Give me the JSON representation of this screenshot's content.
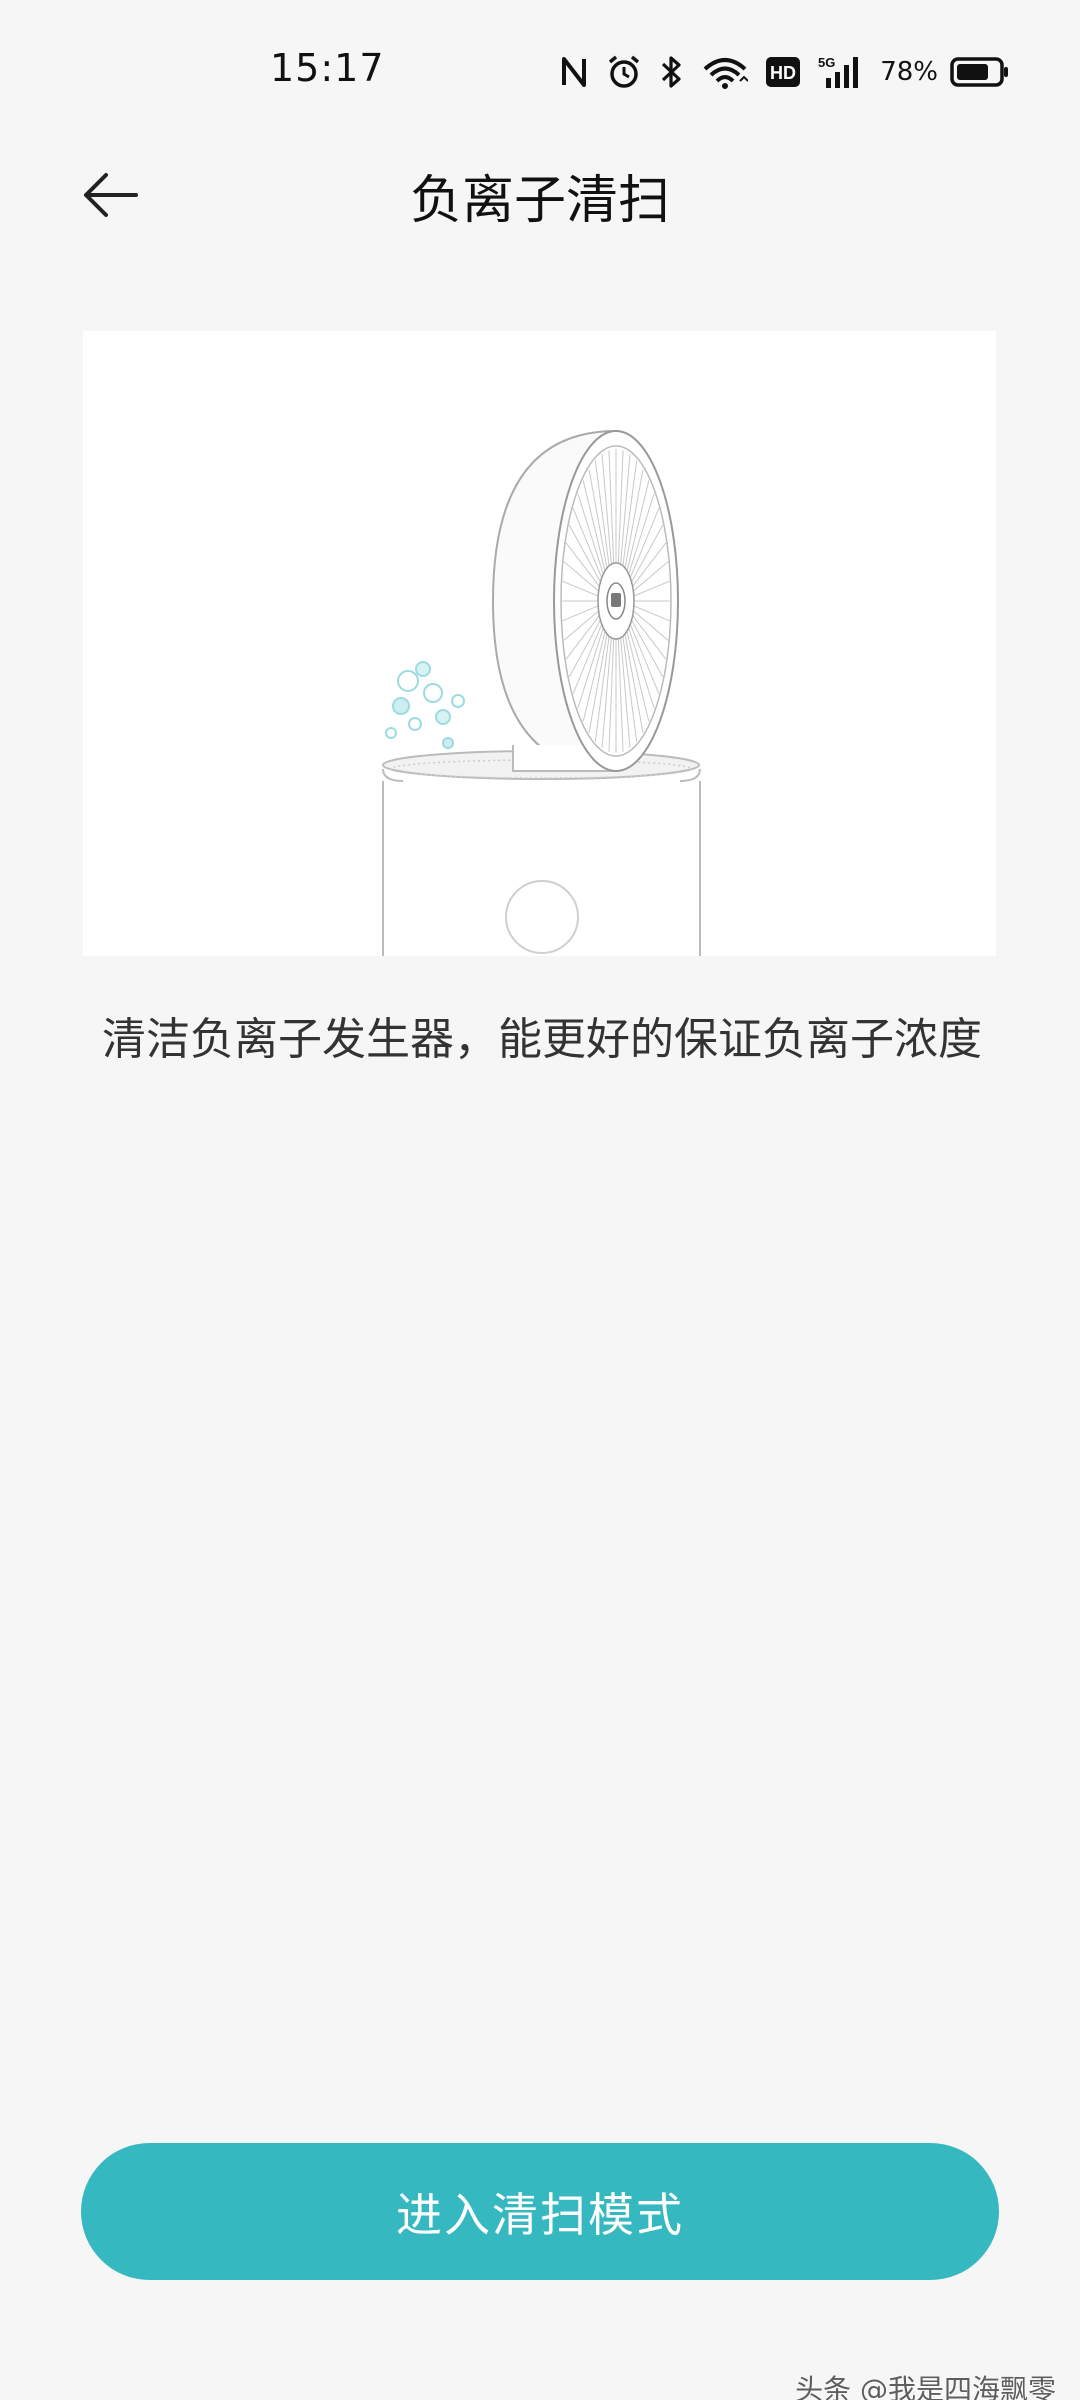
{
  "status_bar": {
    "time": "15:17",
    "network_label": "5G",
    "hd_label": "HD",
    "battery_percent": "78%",
    "battery_level": 0.78,
    "icons": [
      "nfc-icon",
      "alarm-icon",
      "bluetooth-icon",
      "wifi-icon",
      "hd-icon",
      "signal-icon",
      "battery-icon"
    ]
  },
  "header": {
    "title": "负离子清扫",
    "back_icon": "arrow-left-icon"
  },
  "main": {
    "illustration": "fan-purifier-illustration",
    "description": "清洁负离子发生器，能更好的保证负离子浓度"
  },
  "action": {
    "button_label": "进入清扫模式",
    "button_color": "#35b8bf"
  },
  "watermark": "头条 @我是四海飘零"
}
